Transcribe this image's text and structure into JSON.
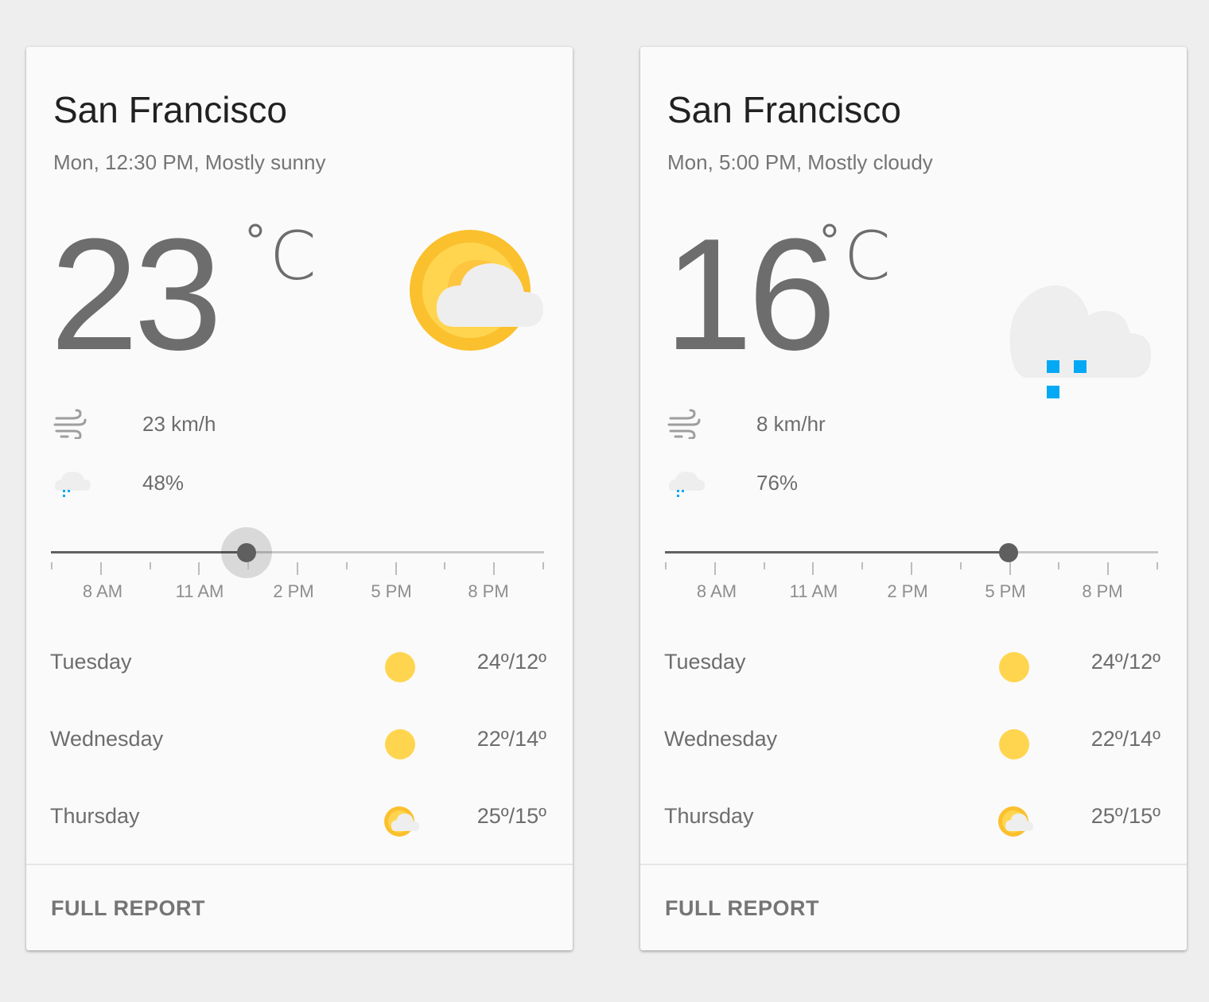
{
  "cards": [
    {
      "city": "San Francisco",
      "subtitle": "Mon, 12:30 PM, Mostly sunny",
      "temperature": "23",
      "temp_unit_degree": "°",
      "temp_unit_letter": "C",
      "condition_icon": "partly-cloudy-icon",
      "wind": {
        "icon": "wind-icon",
        "value": "23 km/h"
      },
      "precipitation": {
        "icon": "rain-cloud-icon",
        "value": "48%"
      },
      "time_slider": {
        "labels": [
          "8 AM",
          "11 AM",
          "2 PM",
          "5 PM",
          "8 PM"
        ],
        "selected_fraction": 0.397,
        "focused": true
      },
      "forecast": [
        {
          "day": "Tuesday",
          "icon": "sun-icon",
          "range": "24º/12º"
        },
        {
          "day": "Wednesday",
          "icon": "sun-icon",
          "range": "22º/14º"
        },
        {
          "day": "Thursday",
          "icon": "partly-cloudy-icon",
          "range": "25º/15º"
        }
      ],
      "full_report_label": "FULL REPORT"
    },
    {
      "city": "San Francisco",
      "subtitle": "Mon, 5:00 PM, Mostly cloudy",
      "temperature": "16",
      "temp_unit_degree": "°",
      "temp_unit_letter": "C",
      "condition_icon": "rain-cloud-icon",
      "wind": {
        "icon": "wind-icon",
        "value": "8 km/hr"
      },
      "precipitation": {
        "icon": "rain-cloud-icon",
        "value": "76%"
      },
      "time_slider": {
        "labels": [
          "8 AM",
          "11 AM",
          "2 PM",
          "5 PM",
          "8 PM"
        ],
        "selected_fraction": 0.696,
        "focused": false
      },
      "forecast": [
        {
          "day": "Tuesday",
          "icon": "sun-icon",
          "range": "24º/12º"
        },
        {
          "day": "Wednesday",
          "icon": "sun-icon",
          "range": "22º/14º"
        },
        {
          "day": "Thursday",
          "icon": "partly-cloudy-icon",
          "range": "25º/15º"
        }
      ],
      "full_report_label": "FULL REPORT"
    }
  ],
  "colors": {
    "sun": "#FFD54F",
    "sun_ring": "#FBC02D",
    "cloud": "#EEEEEE",
    "rain": "#03A9F4",
    "slider_active": "#616161",
    "slider_inactive": "#C8C8C8"
  }
}
